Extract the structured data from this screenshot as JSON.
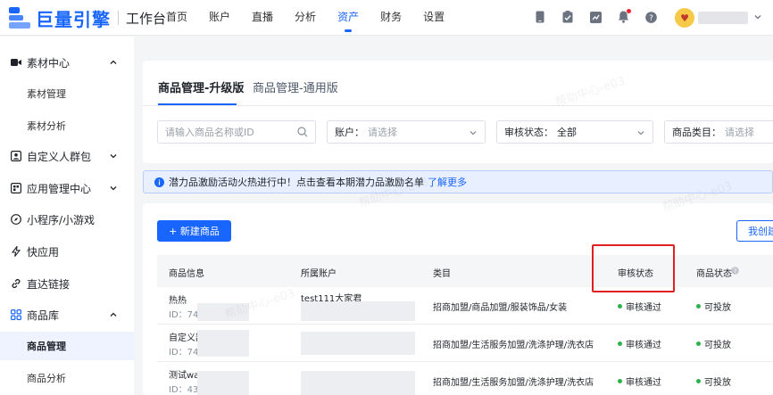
{
  "header": {
    "logo_text": "巨量引擎",
    "logo_sub": "工作台",
    "nav": [
      {
        "label": "首页"
      },
      {
        "label": "账户"
      },
      {
        "label": "直播"
      },
      {
        "label": "分析"
      },
      {
        "label": "资产",
        "active": true
      },
      {
        "label": "财务"
      },
      {
        "label": "设置"
      }
    ],
    "icons": [
      "phone-icon",
      "clipboard-icon",
      "chart-icon",
      "bell-icon",
      "help-icon"
    ],
    "avatar_glyph": "♥"
  },
  "sidebar": {
    "items": [
      {
        "label": "素材中心",
        "icon": "video-icon",
        "expanded": true,
        "children": [
          "素材管理",
          "素材分析"
        ]
      },
      {
        "label": "自定义人群包",
        "icon": "user-group-icon",
        "expanded": false
      },
      {
        "label": "应用管理中心",
        "icon": "app-grid-icon",
        "expanded": false
      },
      {
        "label": "小程序/小游戏",
        "icon": "compass-icon"
      },
      {
        "label": "快应用",
        "icon": "lightning-icon"
      },
      {
        "label": "直达链接",
        "icon": "link-icon"
      },
      {
        "label": "商品库",
        "icon": "product-grid-icon",
        "expanded": true,
        "children": [
          "商品管理",
          "商品分析"
        ],
        "active_child": "商品管理"
      }
    ]
  },
  "main": {
    "tabs": [
      {
        "label": "商品管理-升级版",
        "active": true
      },
      {
        "label": "商品管理-通用版",
        "active": false
      }
    ],
    "filters": {
      "search_placeholder": "请输入商品名称或ID",
      "account_label": "账户：",
      "account_placeholder": "请选择",
      "review_label": "审核状态：",
      "review_value": "全部",
      "category_label": "商品类目：",
      "category_placeholder": "请选择"
    },
    "notice": {
      "text": "潜力品激励活动火热进行中！点击查看本期潜力品激励名单",
      "link": "了解更多"
    },
    "create_button": "+ 新建商品",
    "my_created_button": "我创建",
    "table": {
      "headers": [
        "商品信息",
        "所属账户",
        "类目",
        "审核状态",
        "商品状态"
      ],
      "rows": [
        {
          "name": "热热",
          "id": "ID：743",
          "account": "test111大家君",
          "category": "招商加盟/商品加盟/服装饰品/女装",
          "review": "审核通过",
          "status": "可投放"
        },
        {
          "name": "自定义器",
          "id": "ID：743",
          "account": "",
          "category": "招商加盟/生活服务加盟/洗涤护理/洗衣店",
          "review": "审核通过",
          "status": "可投放"
        },
        {
          "name": "测试wa",
          "id": "ID：43",
          "account": "",
          "category": "招商加盟/生活服务加盟/洗涤护理/洗衣店",
          "review": "审核通过",
          "status": "可投放"
        }
      ]
    },
    "watermark": "帮助中心-e03"
  },
  "colors": {
    "accent": "#1966ff",
    "success": "#2bb34a",
    "highlight": "#e02020"
  }
}
